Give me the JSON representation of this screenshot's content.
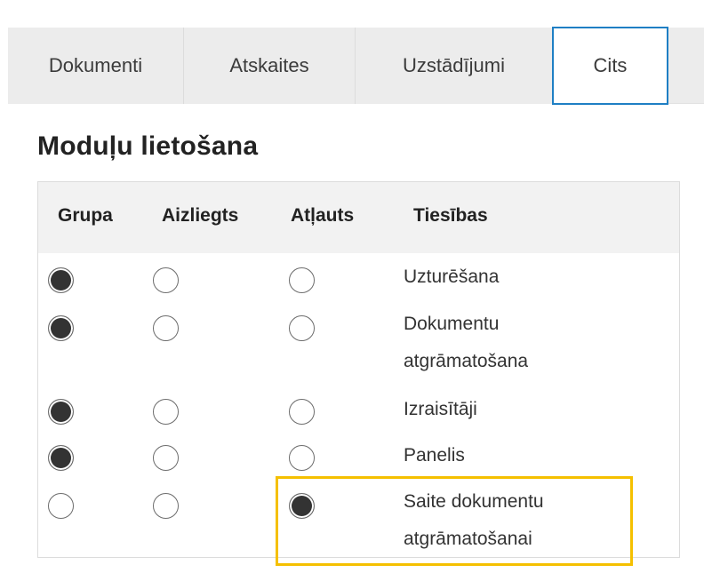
{
  "tabs": [
    {
      "label": "Dokumenti"
    },
    {
      "label": "Atskaites"
    },
    {
      "label": "Uzstādījumi"
    },
    {
      "label": "Cits"
    }
  ],
  "module_title": "Moduļu lietošana",
  "table": {
    "headers": [
      "Grupa",
      "Aizliegts",
      "Atļauts",
      "Tiesības"
    ],
    "rows": [
      {
        "right_lines": [
          "Uzturēšana"
        ],
        "selected": "Grupa"
      },
      {
        "right_lines": [
          "Dokumentu",
          "atgrāmatošana"
        ],
        "selected": "Grupa"
      },
      {
        "right_lines": [
          "Izraisītāji"
        ],
        "selected": "Grupa"
      },
      {
        "right_lines": [
          "Panelis"
        ],
        "selected": "Grupa"
      },
      {
        "right_lines": [
          "Saite dokumentu",
          "atgrāmatošanai"
        ],
        "selected": "Atļauts"
      }
    ]
  },
  "colors": {
    "active_tab_border": "#1f7fc4",
    "highlight_border": "#f5c000"
  }
}
